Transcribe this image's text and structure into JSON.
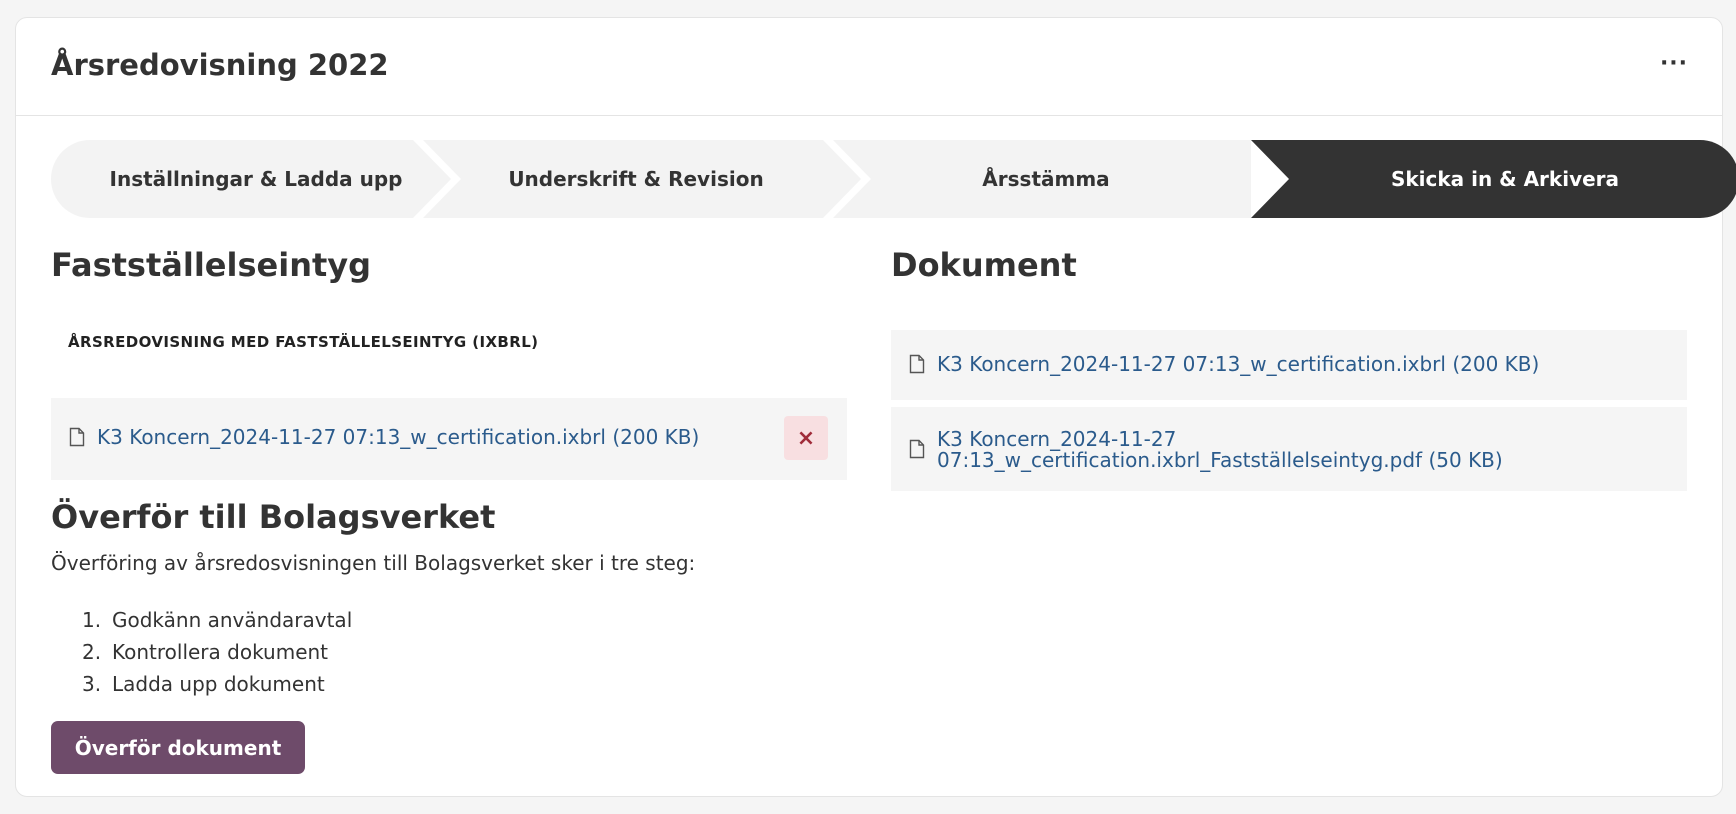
{
  "header": {
    "title": "Årsredovisning 2022",
    "more_label": "···"
  },
  "stepper": {
    "steps": [
      {
        "label": "Inställningar & Ladda upp",
        "active": false
      },
      {
        "label": "Underskrift & Revision",
        "active": false
      },
      {
        "label": "Årsstämma",
        "active": false
      },
      {
        "label": "Skicka in & Arkivera",
        "active": true
      }
    ]
  },
  "certificate": {
    "title": "Fastställelseintyg",
    "subtitle": "ÅRSREDOVISNING MED FASTSTÄLLELSEINTYG (IXBRL)",
    "file": "K3 Koncern_2024-11-27 07:13_w_certification.ixbrl (200 KB)",
    "remove_icon": "×"
  },
  "transfer": {
    "title": "Överför till Bolagsverket",
    "description": "Överföring av årsredosvisningen till Bolagsverket sker i tre steg:",
    "steps": [
      {
        "num": "1.",
        "label": "Godkänn användaravtal"
      },
      {
        "num": "2.",
        "label": "Kontrollera dokument"
      },
      {
        "num": "3.",
        "label": "Ladda upp dokument"
      }
    ],
    "button_label": "Överför dokument"
  },
  "documents": {
    "title": "Dokument",
    "files": [
      {
        "line1": "K3 Koncern_2024-11-27 07:13_w_certification.ixbrl (200 KB)",
        "line2": ""
      },
      {
        "line1": "K3 Koncern_2024-11-27",
        "line2": "07:13_w_certification.ixbrl_Fastställelseintyg.pdf (50 KB)"
      }
    ]
  },
  "colors": {
    "accent": "#6e4b6a",
    "link": "#2b5b8c",
    "active_step": "#333333",
    "remove_bg": "#f8dfe1"
  }
}
